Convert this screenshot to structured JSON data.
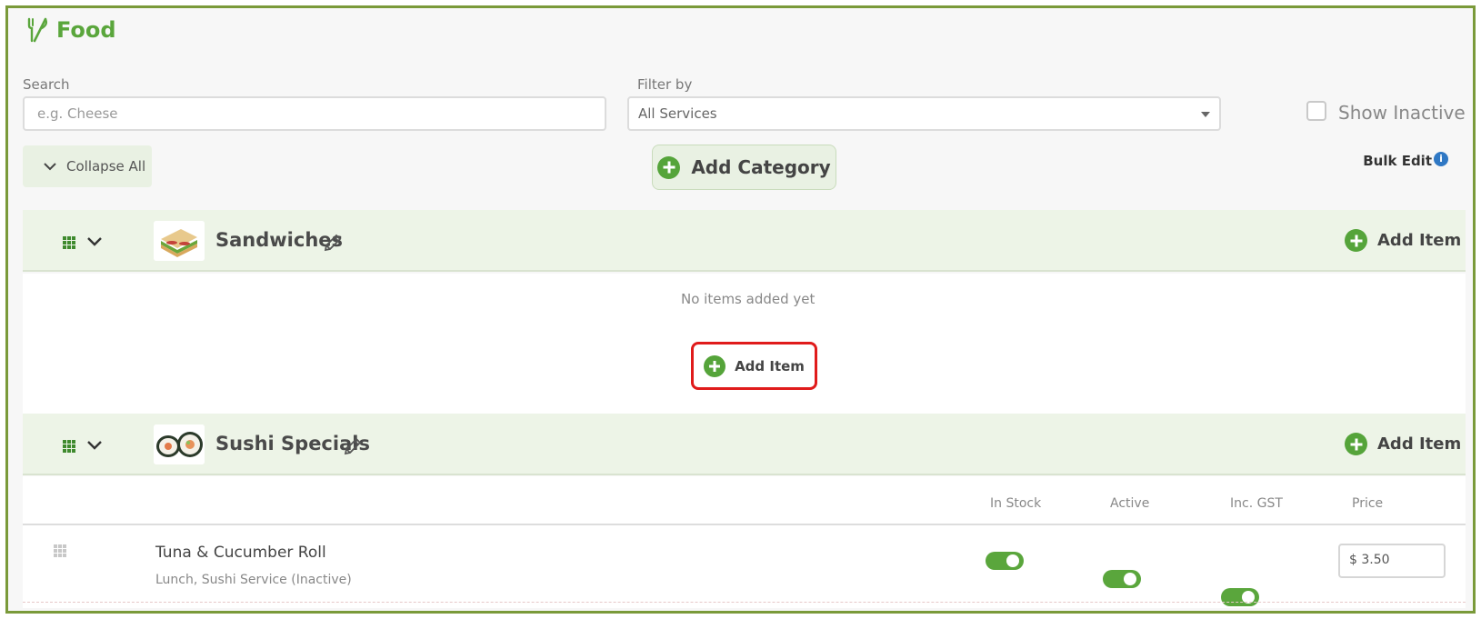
{
  "page": {
    "title": "Food",
    "title_icon": "fork-knife-icon"
  },
  "search": {
    "label": "Search",
    "placeholder": "e.g. Cheese"
  },
  "filter": {
    "label": "Filter by",
    "selected": "All Services"
  },
  "show_inactive": {
    "label": "Show Inactive",
    "checked": false
  },
  "toolbar": {
    "collapse_all_label": "Collapse All",
    "add_category_label": "Add Category",
    "bulk_edit_label": "Bulk Edit"
  },
  "categories": [
    {
      "name": "Sandwiches",
      "add_item_label": "Add Item",
      "empty_text": "No items added yet",
      "empty_add_item_label": "Add Item"
    },
    {
      "name": "Sushi Specials",
      "add_item_label": "Add Item",
      "columns": {
        "in_stock": "In Stock",
        "active": "Active",
        "inc_gst": "Inc. GST",
        "price": "Price"
      },
      "items": [
        {
          "name": "Tuna & Cucumber Roll",
          "subtitle": "Lunch, Sushi Service (Inactive)",
          "in_stock": true,
          "active": true,
          "inc_gst": true,
          "price": "$ 3.50"
        }
      ]
    }
  ],
  "colors": {
    "brand_green": "#5aa63c",
    "highlight_red": "#e01b1b",
    "frame_green": "#7a9a3a"
  }
}
